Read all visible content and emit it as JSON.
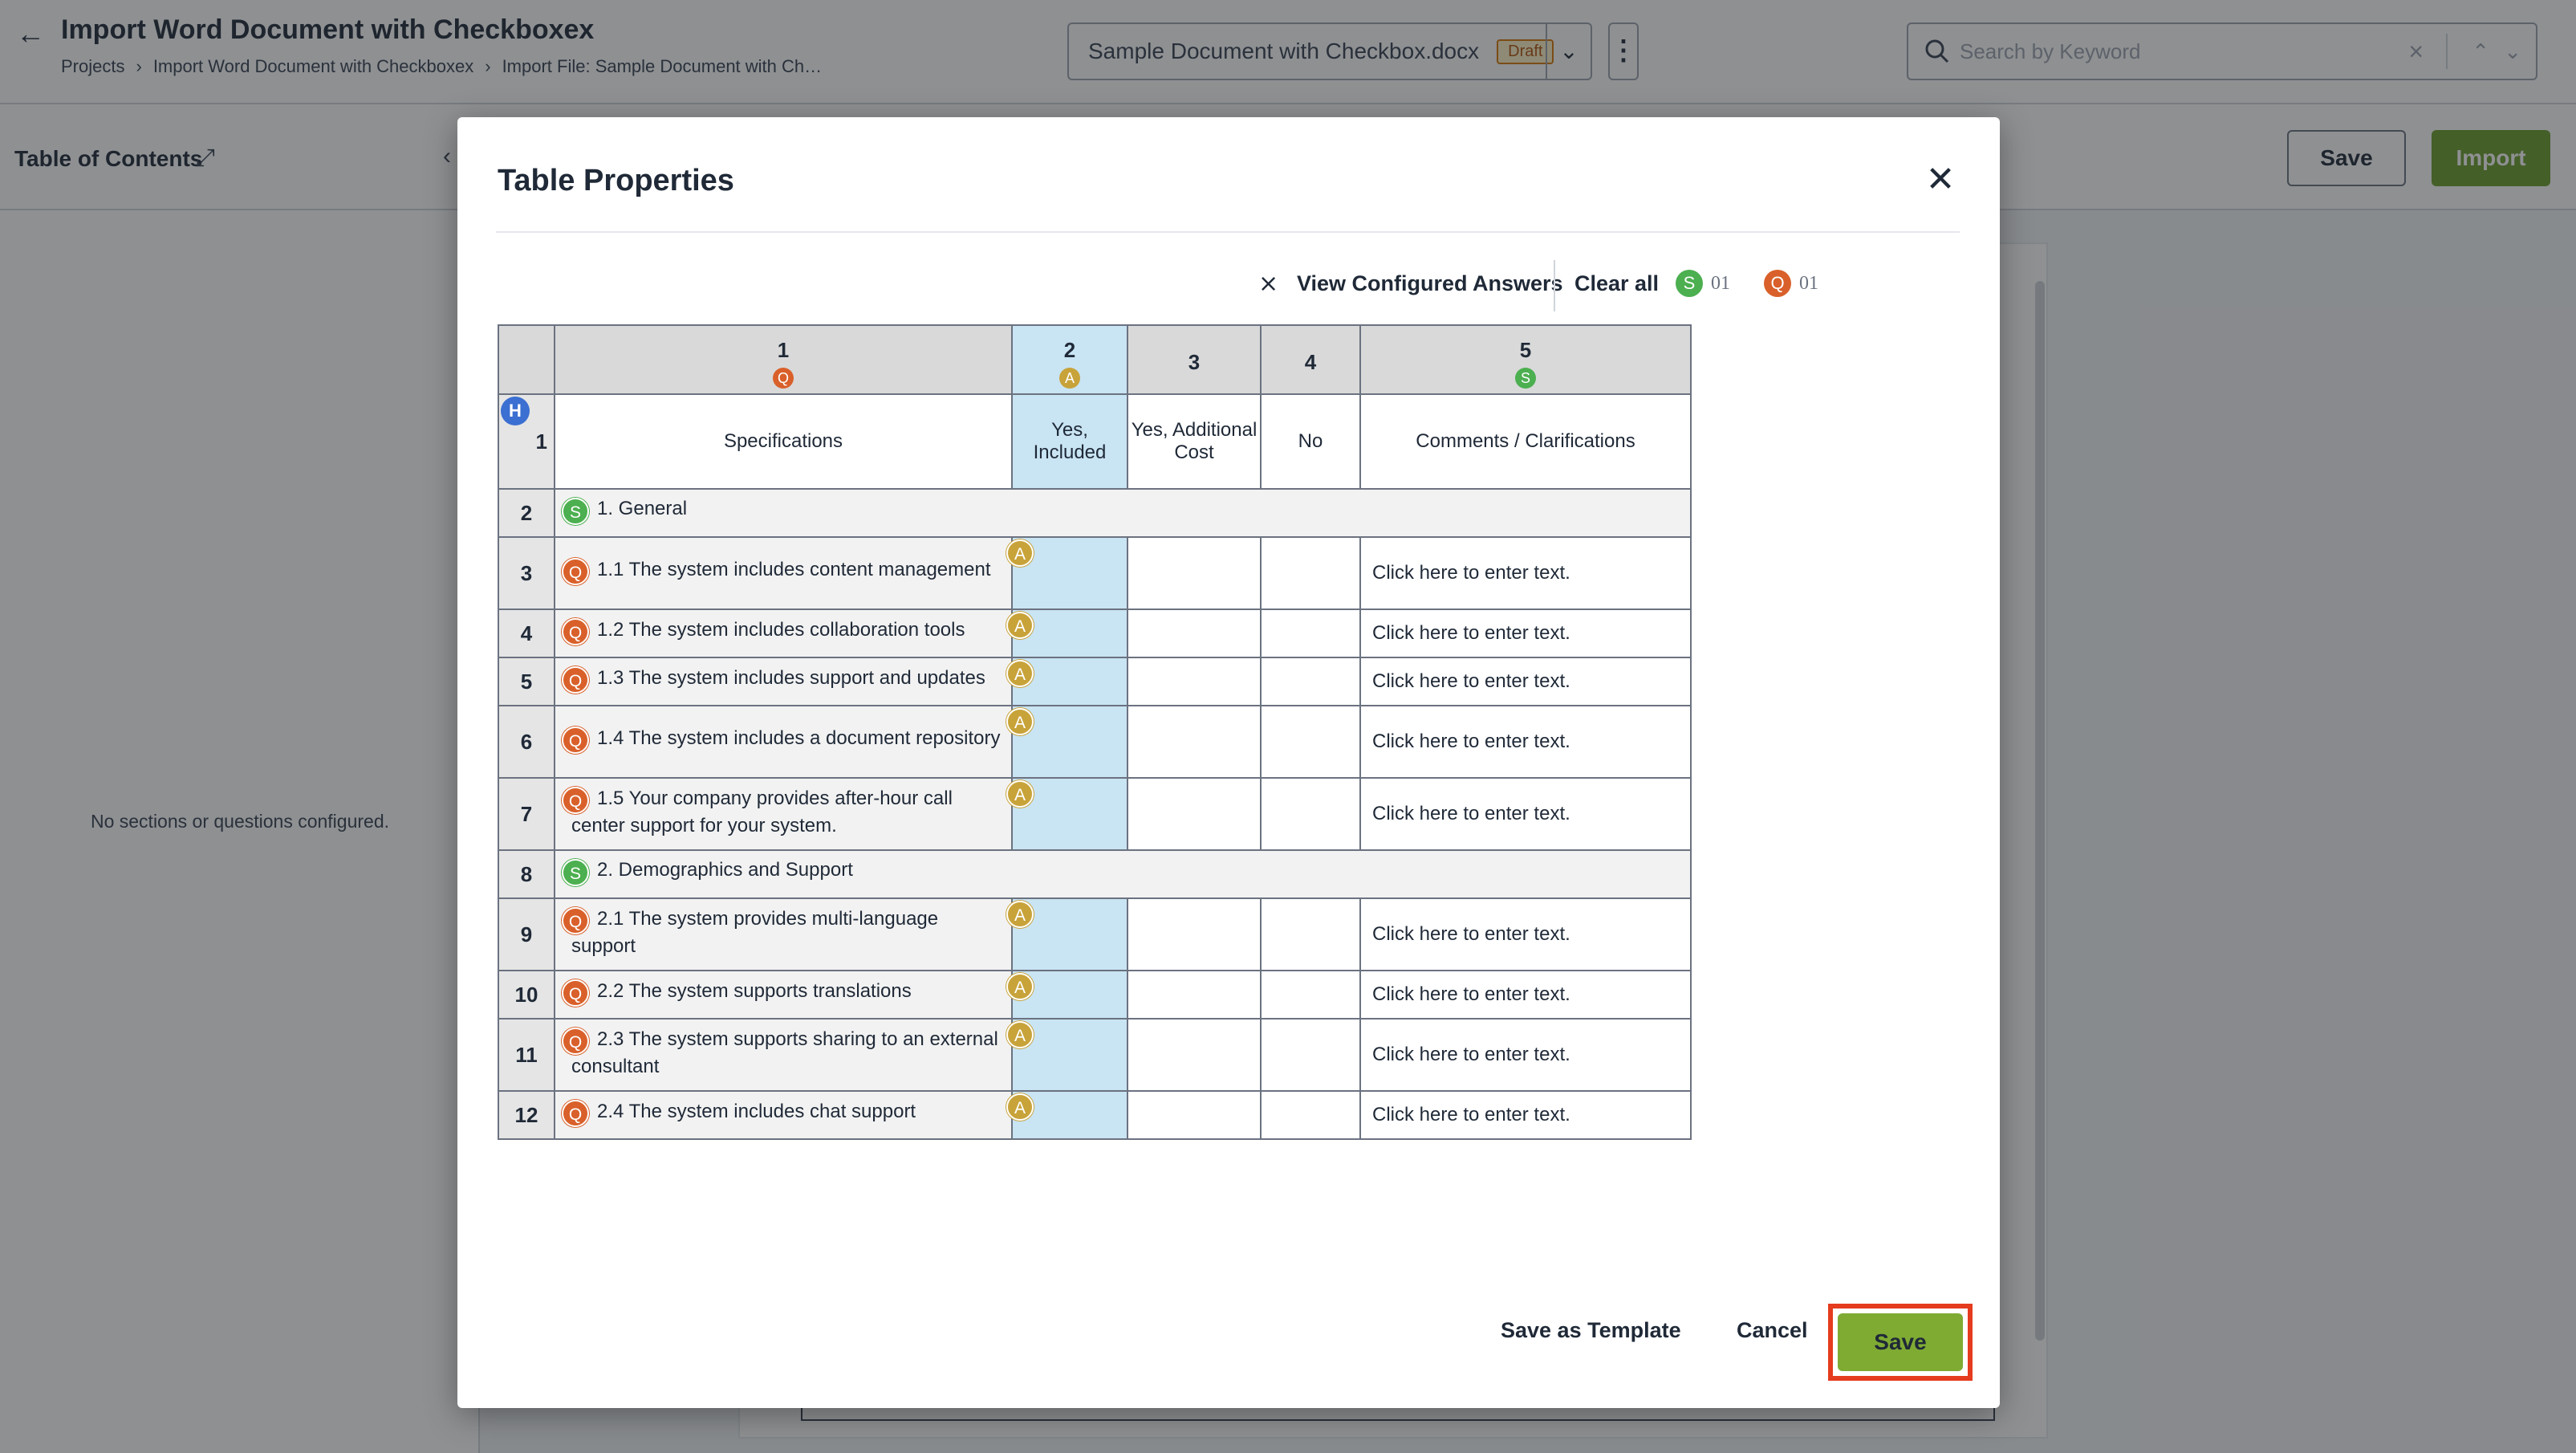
{
  "header": {
    "title": "Import Word Document with Checkboxex",
    "breadcrumb": [
      "Projects",
      "Import Word Document with Checkboxex",
      "Import File:  Sample Document with Ch…"
    ],
    "document": {
      "name": "Sample Document with Checkbox.docx",
      "status": "Draft"
    },
    "search_placeholder": "Search by Keyword"
  },
  "subheader": {
    "toc_title": "Table of Contents",
    "save_label": "Save",
    "import_label": "Import"
  },
  "left_panel": {
    "empty_message": "No sections or questions configured."
  },
  "modal": {
    "title": "Table Properties",
    "toolbar": {
      "view_configured": "View Configured Answers",
      "clear_all": "Clear all",
      "s_count": "01",
      "q_count": "01"
    },
    "columns": [
      {
        "num": "1",
        "badge": "Q"
      },
      {
        "num": "2",
        "badge": "A"
      },
      {
        "num": "3",
        "badge": ""
      },
      {
        "num": "4",
        "badge": ""
      },
      {
        "num": "5",
        "badge": "S"
      }
    ],
    "header_row": {
      "num": "1",
      "badge": "H",
      "cells": [
        "Specifications",
        "Yes, Included",
        "Yes, Additional Cost",
        "No",
        "Comments / Clarifications"
      ]
    },
    "rows": [
      {
        "num": "2",
        "type": "section",
        "badge": "S",
        "text": "1. General"
      },
      {
        "num": "3",
        "type": "question",
        "badge": "Q",
        "text": "1.1 The system includes content management",
        "answer_badge": "A",
        "comment": "Click here to enter text.",
        "tall": true
      },
      {
        "num": "4",
        "type": "question",
        "badge": "Q",
        "text": "1.2 The system includes collaboration tools",
        "answer_badge": "A",
        "comment": "Click here to enter text.",
        "tall": false
      },
      {
        "num": "5",
        "type": "question",
        "badge": "Q",
        "text": "1.3 The system includes support and updates",
        "answer_badge": "A",
        "comment": "Click here to enter text.",
        "tall": false
      },
      {
        "num": "6",
        "type": "question",
        "badge": "Q",
        "text": "1.4 The system includes a document repository",
        "answer_badge": "A",
        "comment": "Click here to enter text.",
        "tall": true
      },
      {
        "num": "7",
        "type": "question",
        "badge": "Q",
        "text": "1.5 Your company provides after-hour call center support for your system.",
        "answer_badge": "A",
        "comment": "Click here to enter text.",
        "tall": true
      },
      {
        "num": "8",
        "type": "section",
        "badge": "S",
        "text": "2. Demographics and Support"
      },
      {
        "num": "9",
        "type": "question",
        "badge": "Q",
        "text": "2.1 The system provides multi-language support",
        "answer_badge": "A",
        "comment": "Click here to enter text.",
        "tall": true
      },
      {
        "num": "10",
        "type": "question",
        "badge": "Q",
        "text": "2.2 The system supports translations",
        "answer_badge": "A",
        "comment": "Click here to enter text.",
        "tall": false
      },
      {
        "num": "11",
        "type": "question",
        "badge": "Q",
        "text": "2.3 The system supports sharing to an external consultant",
        "answer_badge": "A",
        "comment": "Click here to enter text.",
        "tall": true
      },
      {
        "num": "12",
        "type": "question",
        "badge": "Q",
        "text": "2.4 The system includes chat support",
        "answer_badge": "A",
        "comment": "Click here to enter text.",
        "tall": false
      }
    ],
    "footer": {
      "save_template": "Save as Template",
      "cancel": "Cancel",
      "save": "Save"
    }
  },
  "colors": {
    "question_badge": "#d9602a",
    "section_badge": "#4caf50",
    "answer_badge": "#c8a33a",
    "header_badge": "#3b6fd1",
    "primary_green": "#7fab33",
    "highlight_red": "#e53b1e",
    "selected_column": "#c9e4f3"
  }
}
